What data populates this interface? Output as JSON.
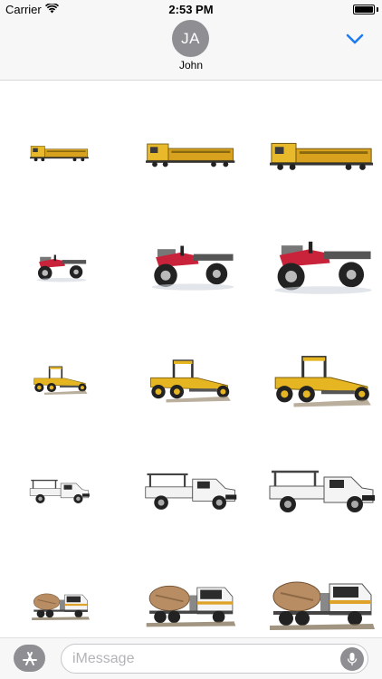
{
  "status_bar": {
    "carrier": "Carrier",
    "time": "2:53 PM",
    "wifi_icon": "wifi-icon",
    "battery_icon": "battery-icon",
    "battery_level": 1.0
  },
  "header": {
    "avatar_initials": "JA",
    "contact_name": "John",
    "collapse_icon": "chevron-down-icon",
    "accent_color": "#1e7cf2"
  },
  "stickers": {
    "rows": [
      {
        "name": "train",
        "items": [
          "train-small",
          "train-medium",
          "train-large"
        ]
      },
      {
        "name": "quad-bike",
        "items": [
          "quad-bike-small",
          "quad-bike-medium",
          "quad-bike-large"
        ]
      },
      {
        "name": "grader",
        "items": [
          "grader-small",
          "grader-medium",
          "grader-large"
        ]
      },
      {
        "name": "ute",
        "items": [
          "ute-small",
          "ute-medium",
          "ute-large"
        ]
      },
      {
        "name": "cement-truck",
        "items": [
          "cement-truck-small",
          "cement-truck-medium",
          "cement-truck-large"
        ]
      }
    ]
  },
  "composer": {
    "appstore_icon": "app-store-icon",
    "placeholder": "iMessage",
    "value": "",
    "mic_icon": "microphone-icon"
  }
}
